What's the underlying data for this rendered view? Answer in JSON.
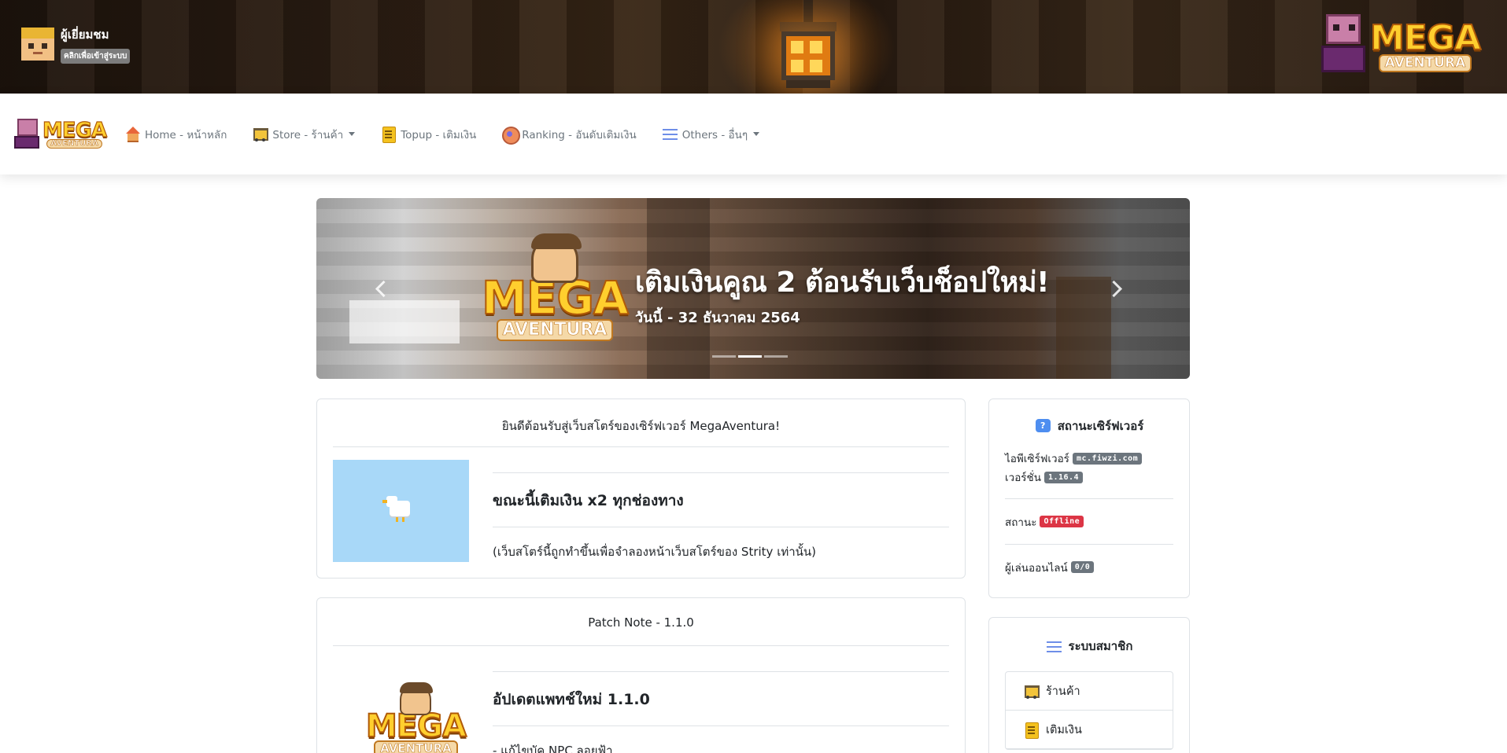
{
  "header": {
    "guest_name": "ผู้เยี่ยมชม",
    "guest_login": "คลิกเพื่อเข้าสู่ระบบ"
  },
  "brand": {
    "logo_word": "MEGA",
    "logo_sub": "AVENTURA"
  },
  "nav": {
    "items": [
      {
        "label": "Home - หน้าหลัก",
        "icon": "home-icon"
      },
      {
        "label": "Store - ร้านค้า",
        "icon": "cart-icon",
        "dropdown": true
      },
      {
        "label": "Topup - เติมเงิน",
        "icon": "bill-icon"
      },
      {
        "label": "Ranking - อันดับเติมเงิน",
        "icon": "ranking-icon"
      },
      {
        "label": "Others - อื่นๆ",
        "icon": "menu-icon",
        "dropdown": true
      }
    ]
  },
  "carousel": {
    "title": "เติมเงินคูณ 2 ต้อนรับเว็บช็อปใหม่!",
    "subtitle": "วันนี้ - 32 ธันวาคม 2564",
    "slides": 3,
    "active_index": 1
  },
  "welcome": {
    "header": "ยินดีต้อนรับสู่เว็บสโตร์ของเซิร์ฟเวอร์ MegaAventura!",
    "title": "ขณะนี้เติมเงิน x2 ทุกช่องทาง",
    "desc": "(เว็บสโตร์นี้ถูกทำขึ้นเพื่อจำลองหน้าเว็บสโตร์ของ Strity เท่านั้น)"
  },
  "patch": {
    "header": "Patch Note - 1.1.0",
    "title": "อัปเดตแพทช์ใหม่ 1.1.0",
    "desc": "- แก้ไขบัค NPC ลอยฟ้า"
  },
  "server_status": {
    "title": "สถานะเซิร์ฟเวอร์",
    "ip_label": "ไอพีเซิร์ฟเวอร์",
    "ip": "mc.fiwzi.com",
    "version_label": "เวอร์ชั่น",
    "version": "1.16.4",
    "status_label": "สถานะ",
    "status": "Offline",
    "players_label": "ผู้เล่นออนไลน์",
    "players": "0/0",
    "status_color": "#dc3545"
  },
  "member": {
    "title": "ระบบสมาชิก",
    "items": [
      {
        "label": "ร้านค้า",
        "icon": "cart-icon"
      },
      {
        "label": "เติมเงิน",
        "icon": "bill-icon"
      }
    ]
  }
}
